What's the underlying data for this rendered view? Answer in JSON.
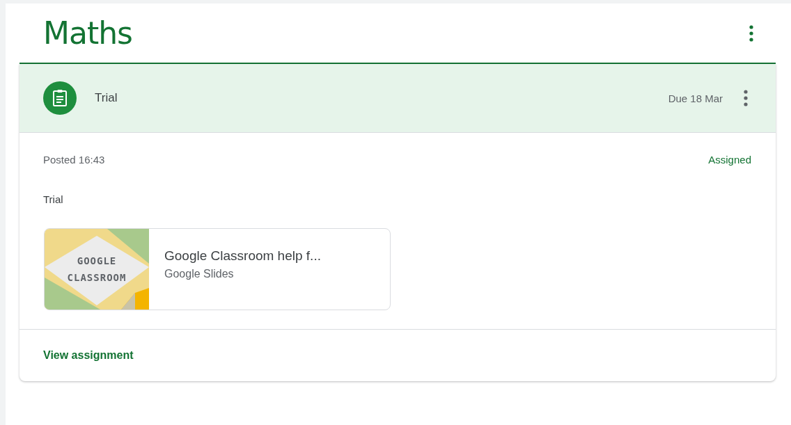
{
  "class_title": "Maths",
  "assignment": {
    "title": "Trial",
    "due": "Due 18 Mar",
    "posted": "Posted 16:43",
    "status": "Assigned",
    "description": "Trial",
    "attachment": {
      "thumbnail_lines": [
        "GOOGLE",
        "CLASSROOM"
      ],
      "title": "Google Classroom help f...",
      "type": "Google Slides"
    },
    "link": "View assignment"
  }
}
